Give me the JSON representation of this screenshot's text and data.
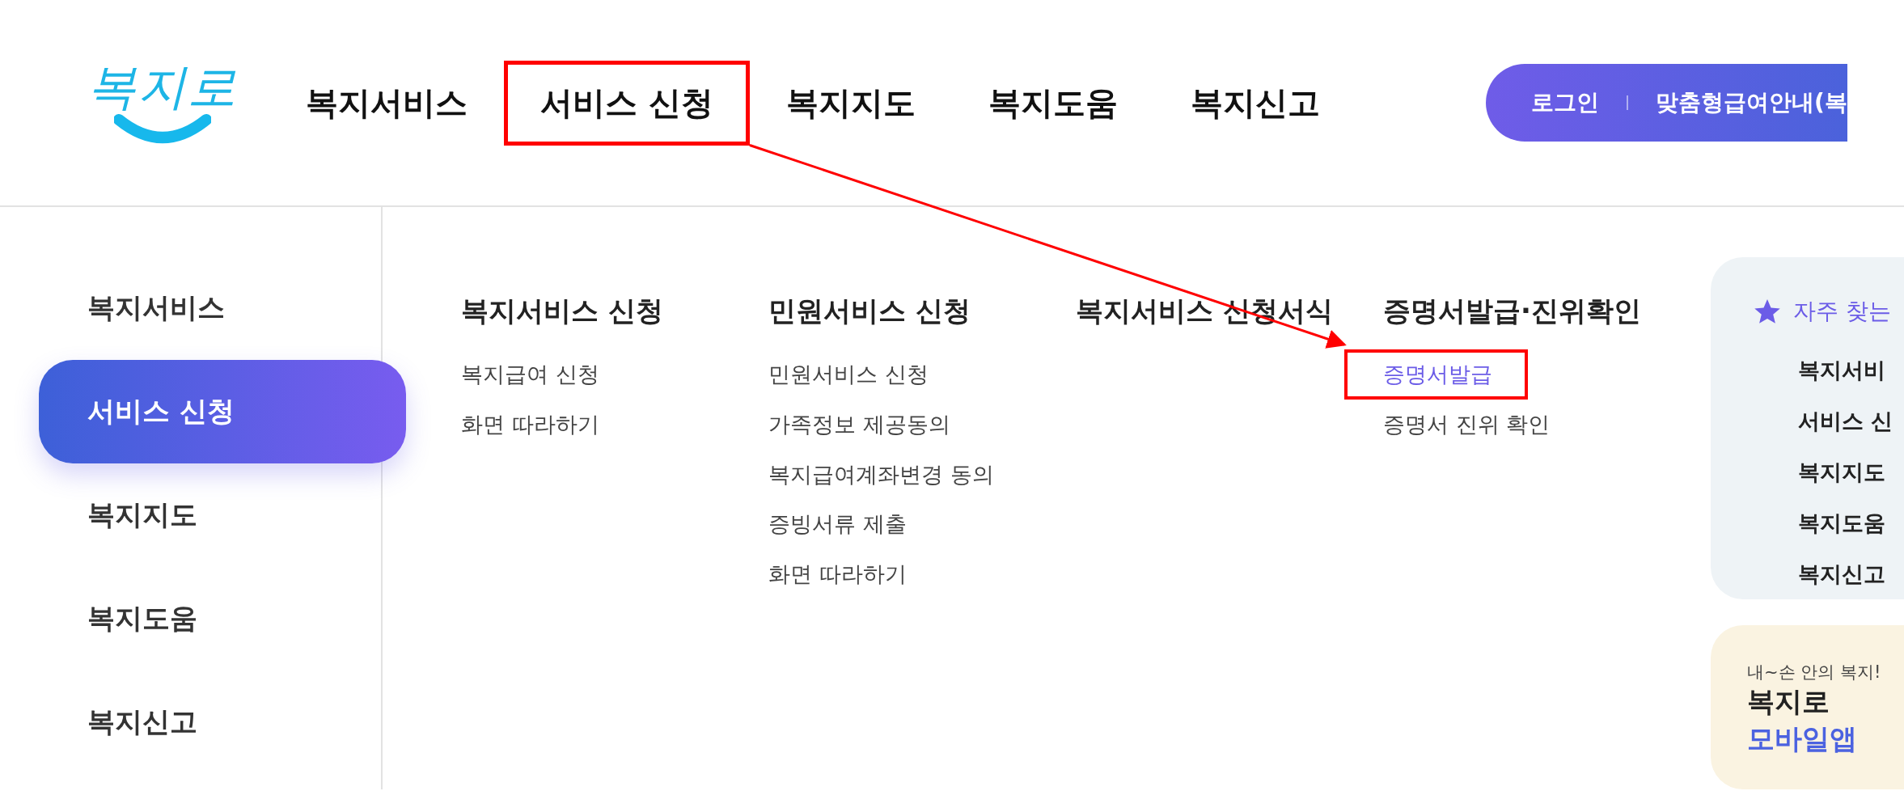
{
  "logo": {
    "text": "복지로"
  },
  "nav": [
    {
      "label": "복지서비스",
      "highlighted": false
    },
    {
      "label": "서비스 신청",
      "highlighted": true
    },
    {
      "label": "복지지도",
      "highlighted": false
    },
    {
      "label": "복지도움",
      "highlighted": false
    },
    {
      "label": "복지신고",
      "highlighted": false
    }
  ],
  "top_links": [
    "로그인",
    "맞춤형급여안내(복"
  ],
  "sidebar": {
    "items": [
      {
        "label": "복지서비스",
        "selected": false
      },
      {
        "label": "서비스 신청",
        "selected": true
      },
      {
        "label": "복지지도",
        "selected": false
      },
      {
        "label": "복지도움",
        "selected": false
      },
      {
        "label": "복지신고",
        "selected": false
      }
    ]
  },
  "menu_columns": [
    {
      "title": "복지서비스 신청",
      "items": [
        {
          "label": "복지급여 신청",
          "highlighted": false
        },
        {
          "label": "화면 따라하기",
          "highlighted": false
        }
      ]
    },
    {
      "title": "민원서비스 신청",
      "items": [
        {
          "label": "민원서비스 신청",
          "highlighted": false
        },
        {
          "label": "가족정보 제공동의",
          "highlighted": false
        },
        {
          "label": "복지급여계좌변경 동의",
          "highlighted": false
        },
        {
          "label": "증빙서류 제출",
          "highlighted": false
        },
        {
          "label": "화면 따라하기",
          "highlighted": false
        }
      ]
    },
    {
      "title": "복지서비스 신청서식"
    },
    {
      "title": "증명서발급·진위확인",
      "items": [
        {
          "label": "증명서발급",
          "highlighted": true
        },
        {
          "label": "증명서 진위 확인",
          "highlighted": false
        }
      ]
    }
  ],
  "callout_arrow": true,
  "favorites": {
    "title": "자주 찾는",
    "items": [
      "복지서비",
      "서비스 신",
      "복지지도",
      "복지도움",
      "복지신고"
    ]
  },
  "app_promo": {
    "tagline": "내~손 안의 복지!",
    "title": "복지로",
    "subtitle": "모바일앱"
  }
}
